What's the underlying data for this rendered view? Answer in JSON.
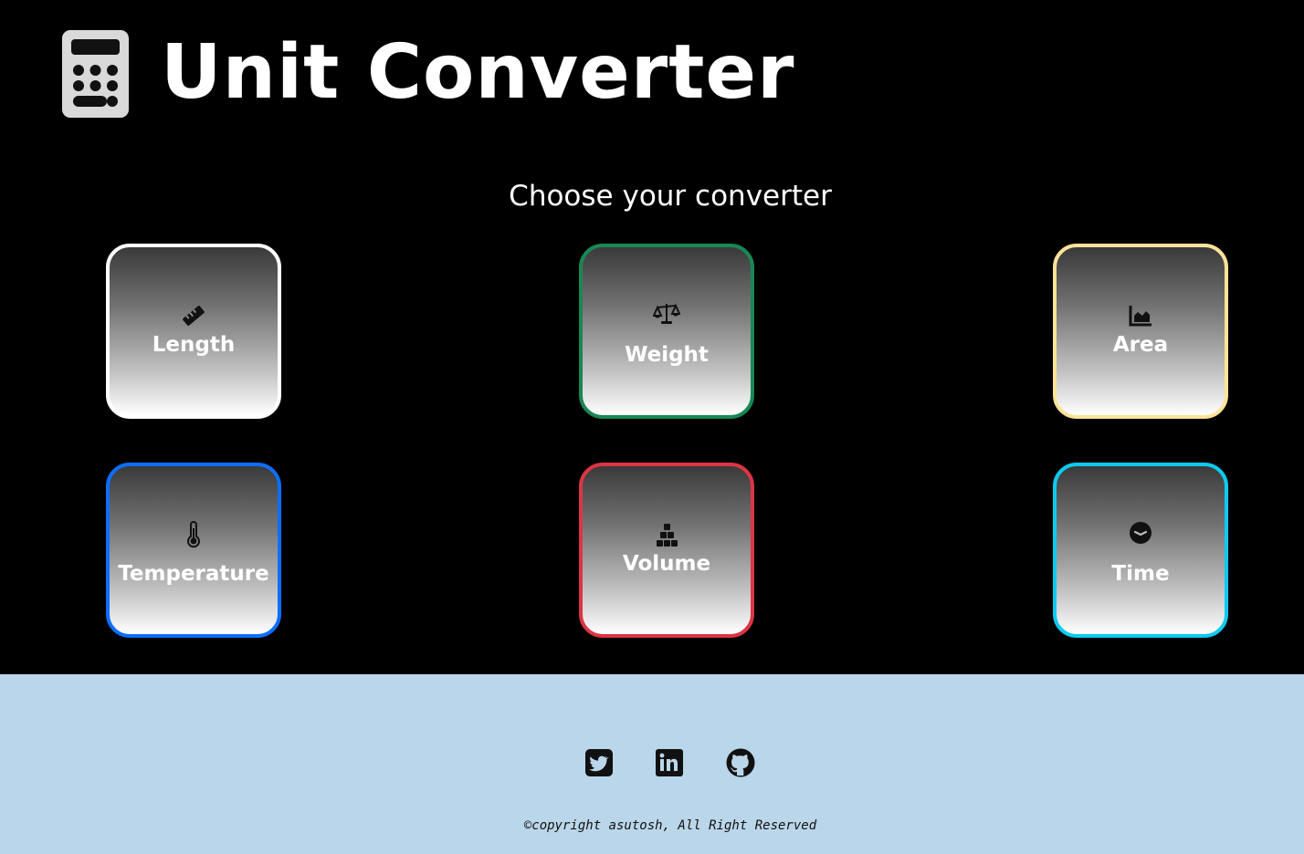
{
  "header": {
    "title": "Unit Converter",
    "logo_icon": "calculator-icon"
  },
  "main": {
    "subtitle": "Choose your converter",
    "converters": [
      {
        "label": "Length",
        "icon": "ruler-icon",
        "border_color": "#ffffff"
      },
      {
        "label": "Weight",
        "icon": "scale-balance-icon",
        "border_color": "#198754"
      },
      {
        "label": "Area",
        "icon": "area-chart-icon",
        "border_color": "#ffe29a"
      },
      {
        "label": "Temperature",
        "icon": "thermometer-icon",
        "border_color": "#0d6efd"
      },
      {
        "label": "Volume",
        "icon": "cubes-stacked-icon",
        "border_color": "#dc3545"
      },
      {
        "label": "Time",
        "icon": "clock-icon",
        "border_color": "#0dcaf0"
      }
    ]
  },
  "footer": {
    "background": "#bad6ea",
    "social": [
      {
        "icon": "twitter-icon"
      },
      {
        "icon": "linkedin-icon"
      },
      {
        "icon": "github-icon"
      }
    ],
    "copyright": "©copyright asutosh, All Right Reserved"
  }
}
